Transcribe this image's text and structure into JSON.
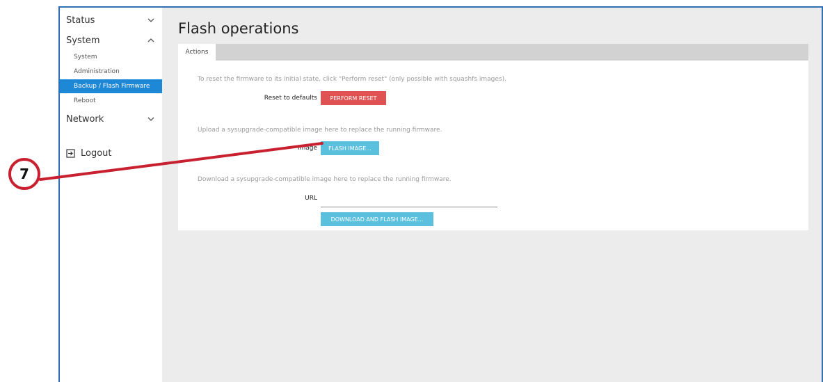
{
  "sidebar": {
    "items": [
      {
        "label": "Status",
        "expanded": false
      },
      {
        "label": "System",
        "expanded": true
      },
      {
        "label": "Network",
        "expanded": false
      }
    ],
    "system_subitems": [
      {
        "label": "System",
        "active": false
      },
      {
        "label": "Administration",
        "active": false
      },
      {
        "label": "Backup / Flash Firmware",
        "active": true
      },
      {
        "label": "Reboot",
        "active": false
      }
    ],
    "logout_label": "Logout"
  },
  "page": {
    "title": "Flash operations",
    "tabs": [
      {
        "label": "Actions",
        "active": true
      }
    ],
    "reset": {
      "description": "To reset the firmware to its initial state, click \"Perform reset\" (only possible with squashfs images).",
      "label": "Reset to defaults",
      "button": "PERFORM RESET"
    },
    "upload": {
      "description": "Upload a sysupgrade-compatible image here to replace the running firmware.",
      "label": "Image",
      "button": "FLASH IMAGE..."
    },
    "download": {
      "description": "Download a sysupgrade-compatible image here to replace the running firmware.",
      "label": "URL",
      "url_value": "",
      "url_placeholder": "",
      "button": "DOWNLOAD AND FLASH IMAGE..."
    }
  },
  "annotation": {
    "number": "7",
    "color": "#c8202f"
  },
  "colors": {
    "accent": "#1e88d7",
    "danger": "#e05252",
    "info": "#5bc0de"
  }
}
